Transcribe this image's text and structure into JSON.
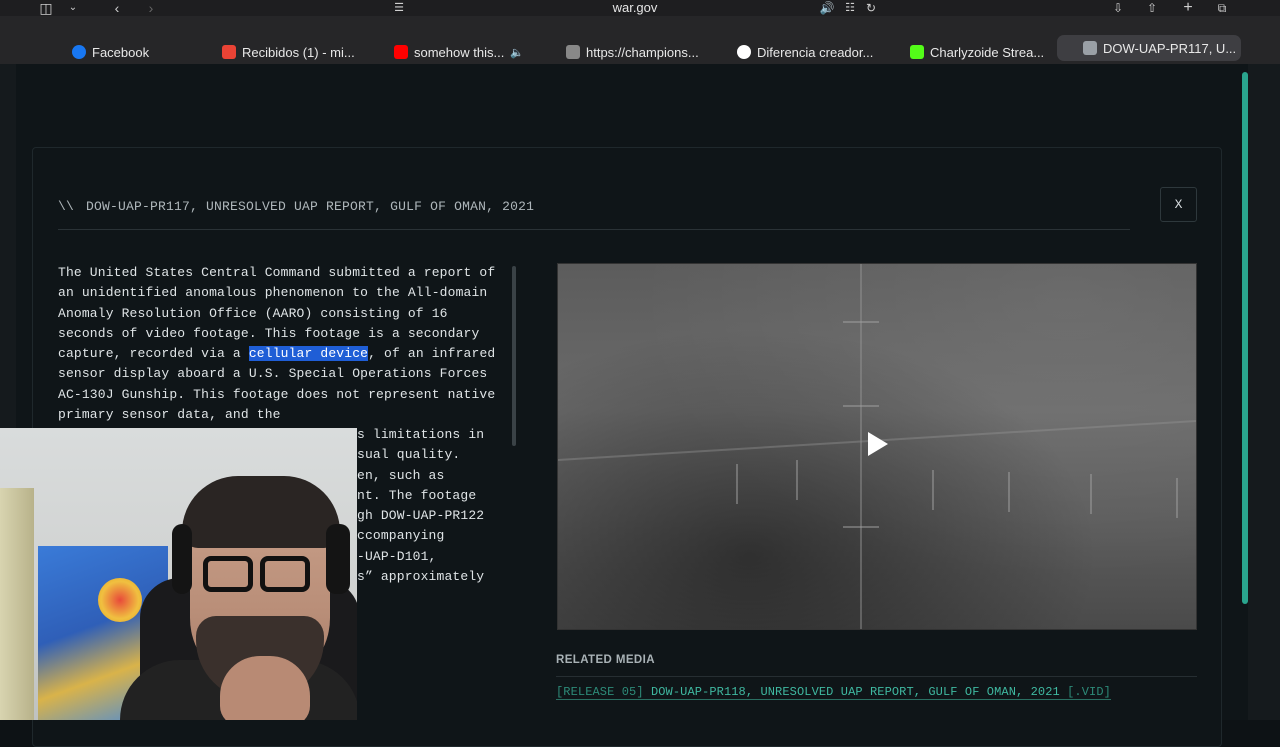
{
  "browser": {
    "url": "war.gov",
    "tabs": [
      {
        "label": "Facebook",
        "color": "#1877f2"
      },
      {
        "label": "Recibidos (1) - mi...",
        "color": "#ea4335"
      },
      {
        "label": "somehow this...",
        "color": "#ff0000"
      },
      {
        "label": "https://champions...",
        "color": "#888888"
      },
      {
        "label": "Diferencia creador...",
        "color": "#ffffff"
      },
      {
        "label": "Charlyzoide Strea...",
        "color": "#53fc18"
      },
      {
        "label": "DOW-UAP-PR117, U...",
        "color": "#9aa0a6"
      }
    ]
  },
  "modal": {
    "prefix": "\\\\",
    "title": "DOW-UAP-PR117, UNRESOLVED UAP REPORT, GULF OF OMAN, 2021",
    "close_label": "X",
    "description_before": "The United States Central Command submitted a report of an unidentified anomalous phenomenon to the All-domain Anomaly Resolution Office (AARO) consisting of 16 seconds of video footage. This footage is a secondary capture, recorded via a ",
    "description_highlight": "cellular device",
    "description_after": ", of an infrared sensor display aboard a U.S. Special Operations Forces AC-130J Gunship. This footage does not represent native primary sensor data, and the",
    "description_tail_lines": [
      "s limitations in",
      "sual quality.",
      "en, such as",
      "nt. The footage",
      "gh DOW-UAP-PR122",
      "ccompanying",
      "-UAP-D101,",
      "s” approximately"
    ]
  },
  "related": {
    "heading": "RELATED MEDIA",
    "item_prefix": "[RELEASE 05]",
    "item_title": "DOW-UAP-PR118, UNRESOLVED UAP REPORT, GULF OF OMAN, 2021",
    "item_suffix": "[.VID]"
  },
  "colors": {
    "accent": "#3fb8a0",
    "selection": "#1f5ed6",
    "page_bg": "#0f1518"
  }
}
